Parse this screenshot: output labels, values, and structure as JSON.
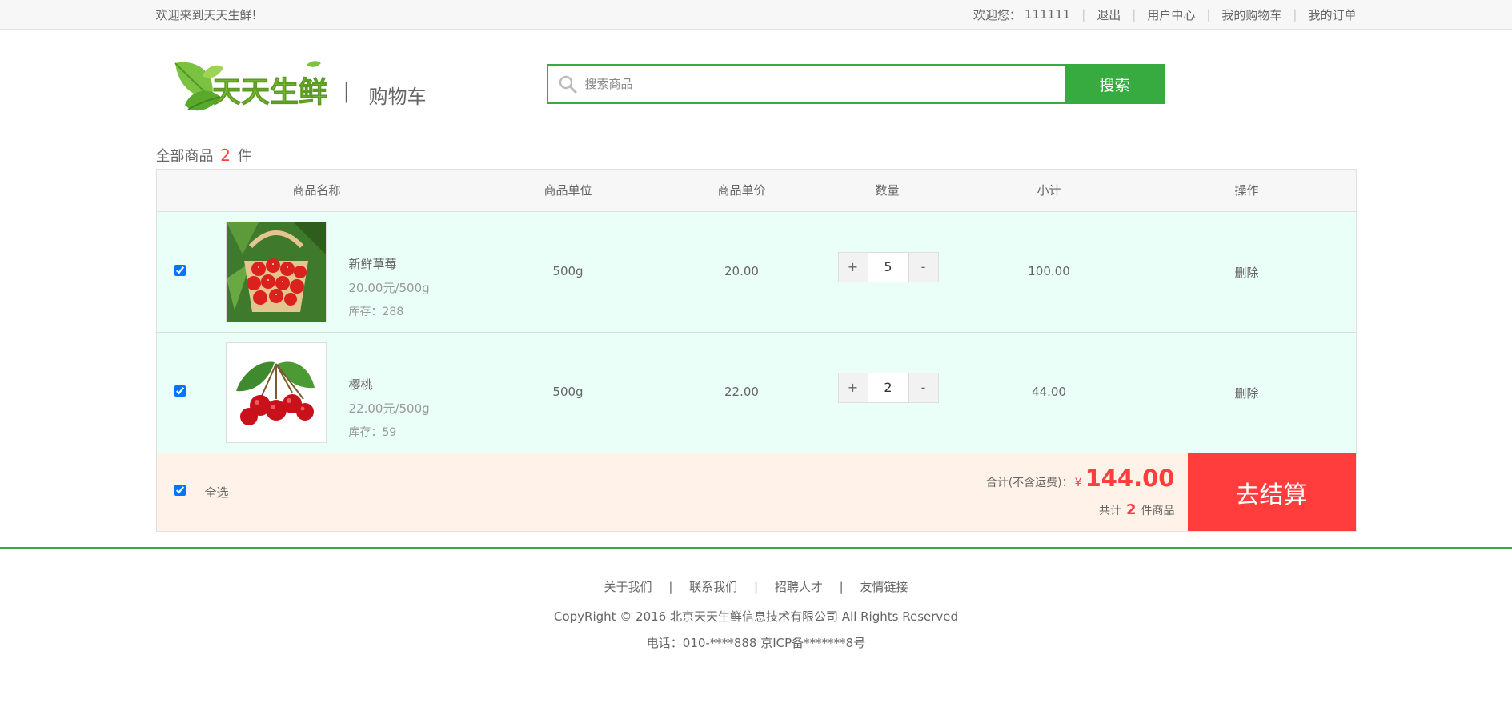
{
  "topbar": {
    "welcome": "欢迎来到天天生鲜!",
    "user_label": "欢迎您：",
    "user_name": "111111",
    "logout": "退出",
    "user_center": "用户中心",
    "my_cart": "我的购物车",
    "my_orders": "我的订单"
  },
  "header": {
    "logo_text": "天天生鲜",
    "separator": "|",
    "page_name": "购物车",
    "search_placeholder": "搜索商品",
    "search_button": "搜索"
  },
  "cart_summary": {
    "prefix": "全部商品",
    "count": "2",
    "suffix": "件"
  },
  "table": {
    "headers": [
      "商品名称",
      "商品单位",
      "商品单价",
      "数量",
      "小计",
      "操作"
    ],
    "rows": [
      {
        "name": "新鲜草莓",
        "price_unit": "20.00元/500g",
        "stock": "库存：288",
        "unit": "500g",
        "price": "20.00",
        "qty": "5",
        "subtotal": "100.00",
        "action": "删除",
        "checked": true
      },
      {
        "name": "樱桃",
        "price_unit": "22.00元/500g",
        "stock": "库存：59",
        "unit": "500g",
        "price": "22.00",
        "qty": "2",
        "subtotal": "44.00",
        "action": "删除",
        "checked": true
      }
    ],
    "plus": "+",
    "minus": "-"
  },
  "settle": {
    "select_all": "全选",
    "total_label": "合计(不含运费)：",
    "currency": "¥",
    "total": "144.00",
    "count_prefix": "共计",
    "count": "2",
    "count_suffix": "件商品",
    "checkout": "去结算"
  },
  "footer": {
    "links": [
      "关于我们",
      "联系我们",
      "招聘人才",
      "友情链接"
    ],
    "separator": "|",
    "copyright": "CopyRight © 2016 北京天天生鲜信息技术有限公司 All Rights Reserved",
    "tel": "电话：010-****888    京ICP备*******8号"
  },
  "colors": {
    "brand_green": "#37ab40",
    "accent_red": "#ff3d3d",
    "row_bg": "#eafff8",
    "settle_bg": "#fff3e9"
  }
}
